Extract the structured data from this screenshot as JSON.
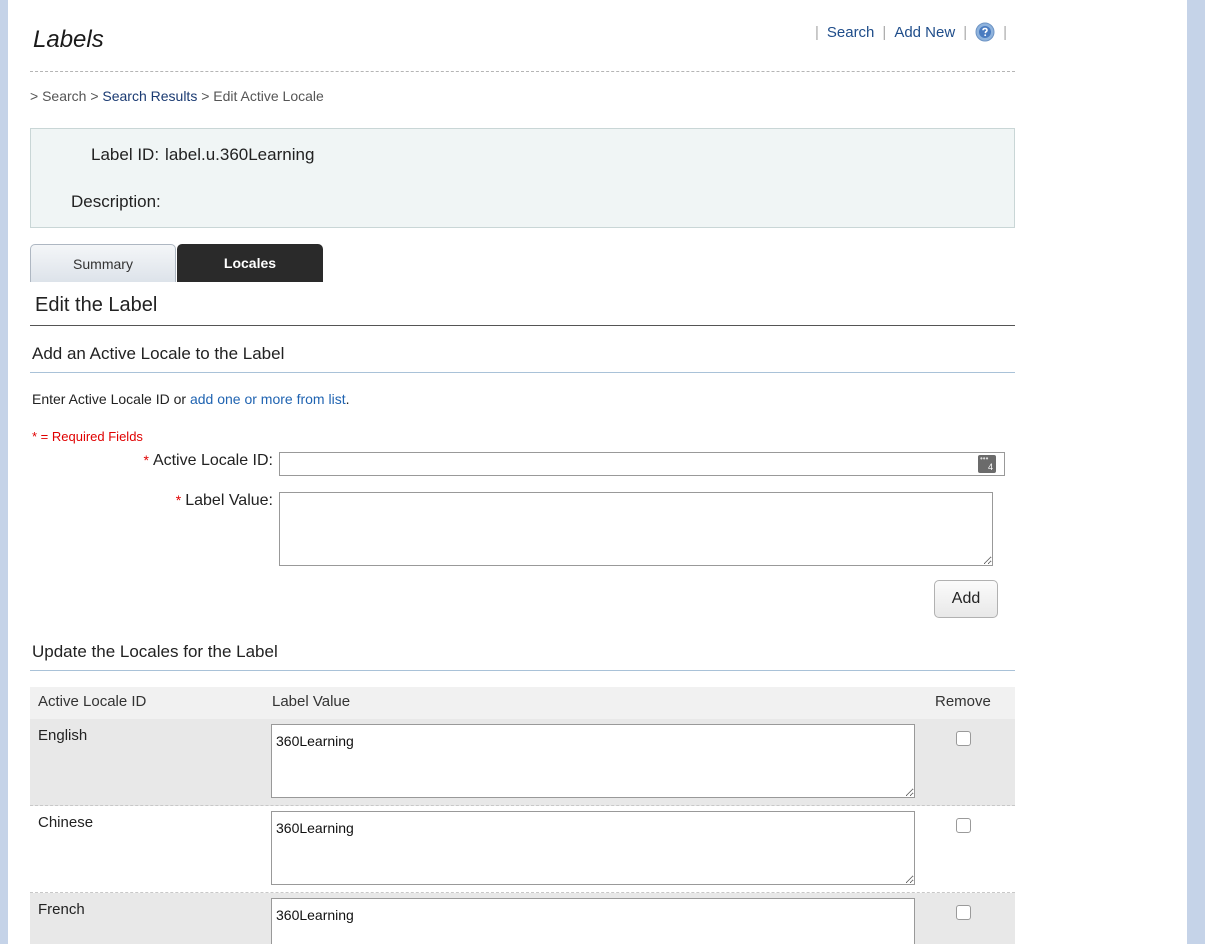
{
  "header": {
    "title": "Labels",
    "links": {
      "search": "Search",
      "add_new": "Add New",
      "separator": "|"
    },
    "help_icon": "help-icon"
  },
  "breadcrumb": {
    "prefix": "> Search > ",
    "link": "Search Results",
    "suffix": " > Edit Active Locale"
  },
  "info": {
    "label_id_caption": "Label ID:",
    "label_id_value": "label.u.360Learning",
    "description_caption": "Description:",
    "description_value": ""
  },
  "tabs": {
    "summary": "Summary",
    "locales": "Locales",
    "active": "Locales"
  },
  "section_title": "Edit the Label",
  "add_section": {
    "title": "Add an Active Locale to the Label",
    "instruction_prefix": "Enter Active Locale ID or ",
    "instruction_link": "add one or more from list",
    "instruction_suffix": ".",
    "required_note": "* = Required Fields",
    "star": "*",
    "locale_label": "Active Locale ID:",
    "locale_value": "",
    "value_label": "Label Value:",
    "value_value": "",
    "add_button": "Add"
  },
  "update_section": {
    "title": "Update the Locales for the Label",
    "columns": {
      "locale": "Active Locale ID",
      "value": "Label Value",
      "remove": "Remove"
    },
    "rows": [
      {
        "locale": "English",
        "value": "360Learning",
        "remove": false
      },
      {
        "locale": "Chinese",
        "value": "360Learning",
        "remove": false
      },
      {
        "locale": "French",
        "value": "360Learning",
        "remove": false
      }
    ]
  },
  "colors": {
    "link": "#1f63b1",
    "required": "#e00000",
    "tab_active_bg": "#2a2a2a",
    "frame": "#c5d3e8"
  }
}
